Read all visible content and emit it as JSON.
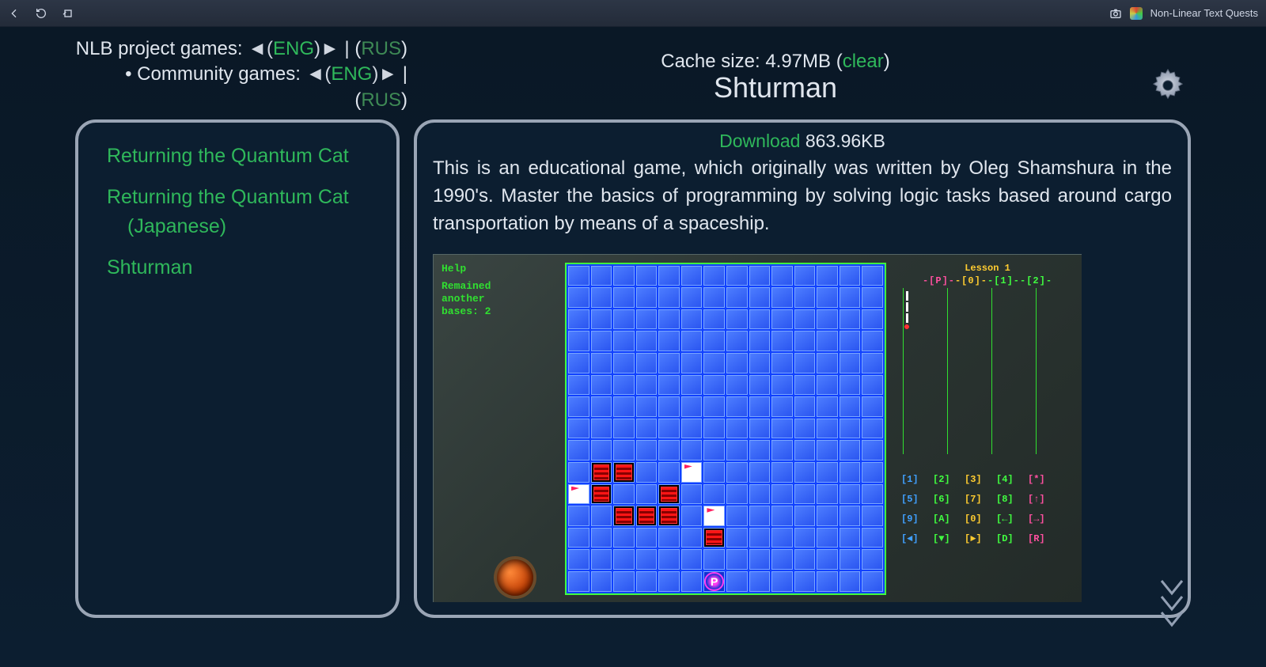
{
  "topbar": {
    "app_title": "Non-Linear Text Quests"
  },
  "header": {
    "line1_label": "NLB project games: ",
    "line2_bullet": "• ",
    "line2_label": "Community games: ",
    "lang_eng": "ENG",
    "lang_rus": "RUS",
    "arrow_l": "◄(",
    "arrow_r": ")►",
    "sep": " | (",
    "close": ")"
  },
  "cache": {
    "prefix": "Cache size: ",
    "size": "4.97MB",
    "open": " (",
    "clear": "clear",
    "close": ")"
  },
  "title": "Shturman",
  "download": {
    "label": "Download",
    "size": " 863.96KB"
  },
  "description": "This is an educational game, which originally was written by Oleg Shamshura in the 1990's. Master the basics of programming by solving logic tasks based around cargo transportation by means of a spaceship.",
  "sidebar": {
    "items": [
      "Returning the Quantum Cat",
      "Returning the Quantum Cat (Japanese)",
      "Shturman"
    ]
  },
  "preview": {
    "hud_help": "Help",
    "hud_line1": "Remained",
    "hud_line2": "another",
    "hud_line3": "bases: 2",
    "lesson_title": "Lesson 1",
    "lesson_cols": {
      "p": "-[P]-",
      "o": "-[0]-",
      "n1": "-[1]-",
      "n2": "-[2]-"
    },
    "grid": {
      "cols": 14,
      "rows": 15,
      "red": [
        [
          9,
          1
        ],
        [
          9,
          2
        ],
        [
          10,
          1
        ],
        [
          11,
          2
        ],
        [
          10,
          4
        ],
        [
          11,
          3
        ],
        [
          11,
          4
        ],
        [
          12,
          6
        ]
      ],
      "white": [
        [
          9,
          5
        ],
        [
          10,
          0
        ],
        [
          11,
          6
        ]
      ],
      "player": [
        [
          14,
          6
        ]
      ]
    },
    "keys": [
      [
        "[1]",
        "[2]",
        "[3]",
        "[4]",
        "[*]"
      ],
      [
        "[5]",
        "[6]",
        "[7]",
        "[8]",
        "[↑]"
      ],
      [
        "[9]",
        "[A]",
        "[0]",
        "[←]",
        "[→]"
      ],
      [
        "[◄]",
        "[▼]",
        "[►]",
        "[D]",
        "[R]"
      ]
    ]
  }
}
